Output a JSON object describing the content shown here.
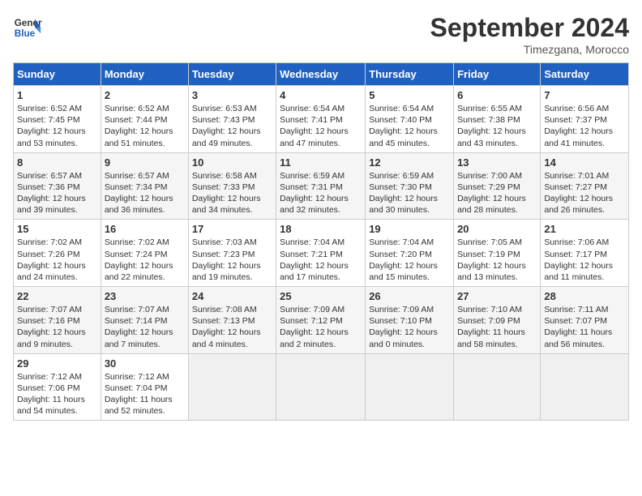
{
  "header": {
    "logo_line1": "General",
    "logo_line2": "Blue",
    "month": "September 2024",
    "location": "Timezgana, Morocco"
  },
  "days_of_week": [
    "Sunday",
    "Monday",
    "Tuesday",
    "Wednesday",
    "Thursday",
    "Friday",
    "Saturday"
  ],
  "weeks": [
    [
      {
        "num": "1",
        "info": "Sunrise: 6:52 AM\nSunset: 7:45 PM\nDaylight: 12 hours\nand 53 minutes."
      },
      {
        "num": "2",
        "info": "Sunrise: 6:52 AM\nSunset: 7:44 PM\nDaylight: 12 hours\nand 51 minutes."
      },
      {
        "num": "3",
        "info": "Sunrise: 6:53 AM\nSunset: 7:43 PM\nDaylight: 12 hours\nand 49 minutes."
      },
      {
        "num": "4",
        "info": "Sunrise: 6:54 AM\nSunset: 7:41 PM\nDaylight: 12 hours\nand 47 minutes."
      },
      {
        "num": "5",
        "info": "Sunrise: 6:54 AM\nSunset: 7:40 PM\nDaylight: 12 hours\nand 45 minutes."
      },
      {
        "num": "6",
        "info": "Sunrise: 6:55 AM\nSunset: 7:38 PM\nDaylight: 12 hours\nand 43 minutes."
      },
      {
        "num": "7",
        "info": "Sunrise: 6:56 AM\nSunset: 7:37 PM\nDaylight: 12 hours\nand 41 minutes."
      }
    ],
    [
      {
        "num": "8",
        "info": "Sunrise: 6:57 AM\nSunset: 7:36 PM\nDaylight: 12 hours\nand 39 minutes."
      },
      {
        "num": "9",
        "info": "Sunrise: 6:57 AM\nSunset: 7:34 PM\nDaylight: 12 hours\nand 36 minutes."
      },
      {
        "num": "10",
        "info": "Sunrise: 6:58 AM\nSunset: 7:33 PM\nDaylight: 12 hours\nand 34 minutes."
      },
      {
        "num": "11",
        "info": "Sunrise: 6:59 AM\nSunset: 7:31 PM\nDaylight: 12 hours\nand 32 minutes."
      },
      {
        "num": "12",
        "info": "Sunrise: 6:59 AM\nSunset: 7:30 PM\nDaylight: 12 hours\nand 30 minutes."
      },
      {
        "num": "13",
        "info": "Sunrise: 7:00 AM\nSunset: 7:29 PM\nDaylight: 12 hours\nand 28 minutes."
      },
      {
        "num": "14",
        "info": "Sunrise: 7:01 AM\nSunset: 7:27 PM\nDaylight: 12 hours\nand 26 minutes."
      }
    ],
    [
      {
        "num": "15",
        "info": "Sunrise: 7:02 AM\nSunset: 7:26 PM\nDaylight: 12 hours\nand 24 minutes."
      },
      {
        "num": "16",
        "info": "Sunrise: 7:02 AM\nSunset: 7:24 PM\nDaylight: 12 hours\nand 22 minutes."
      },
      {
        "num": "17",
        "info": "Sunrise: 7:03 AM\nSunset: 7:23 PM\nDaylight: 12 hours\nand 19 minutes."
      },
      {
        "num": "18",
        "info": "Sunrise: 7:04 AM\nSunset: 7:21 PM\nDaylight: 12 hours\nand 17 minutes."
      },
      {
        "num": "19",
        "info": "Sunrise: 7:04 AM\nSunset: 7:20 PM\nDaylight: 12 hours\nand 15 minutes."
      },
      {
        "num": "20",
        "info": "Sunrise: 7:05 AM\nSunset: 7:19 PM\nDaylight: 12 hours\nand 13 minutes."
      },
      {
        "num": "21",
        "info": "Sunrise: 7:06 AM\nSunset: 7:17 PM\nDaylight: 12 hours\nand 11 minutes."
      }
    ],
    [
      {
        "num": "22",
        "info": "Sunrise: 7:07 AM\nSunset: 7:16 PM\nDaylight: 12 hours\nand 9 minutes."
      },
      {
        "num": "23",
        "info": "Sunrise: 7:07 AM\nSunset: 7:14 PM\nDaylight: 12 hours\nand 7 minutes."
      },
      {
        "num": "24",
        "info": "Sunrise: 7:08 AM\nSunset: 7:13 PM\nDaylight: 12 hours\nand 4 minutes."
      },
      {
        "num": "25",
        "info": "Sunrise: 7:09 AM\nSunset: 7:12 PM\nDaylight: 12 hours\nand 2 minutes."
      },
      {
        "num": "26",
        "info": "Sunrise: 7:09 AM\nSunset: 7:10 PM\nDaylight: 12 hours\nand 0 minutes."
      },
      {
        "num": "27",
        "info": "Sunrise: 7:10 AM\nSunset: 7:09 PM\nDaylight: 11 hours\nand 58 minutes."
      },
      {
        "num": "28",
        "info": "Sunrise: 7:11 AM\nSunset: 7:07 PM\nDaylight: 11 hours\nand 56 minutes."
      }
    ],
    [
      {
        "num": "29",
        "info": "Sunrise: 7:12 AM\nSunset: 7:06 PM\nDaylight: 11 hours\nand 54 minutes."
      },
      {
        "num": "30",
        "info": "Sunrise: 7:12 AM\nSunset: 7:04 PM\nDaylight: 11 hours\nand 52 minutes."
      },
      null,
      null,
      null,
      null,
      null
    ]
  ]
}
